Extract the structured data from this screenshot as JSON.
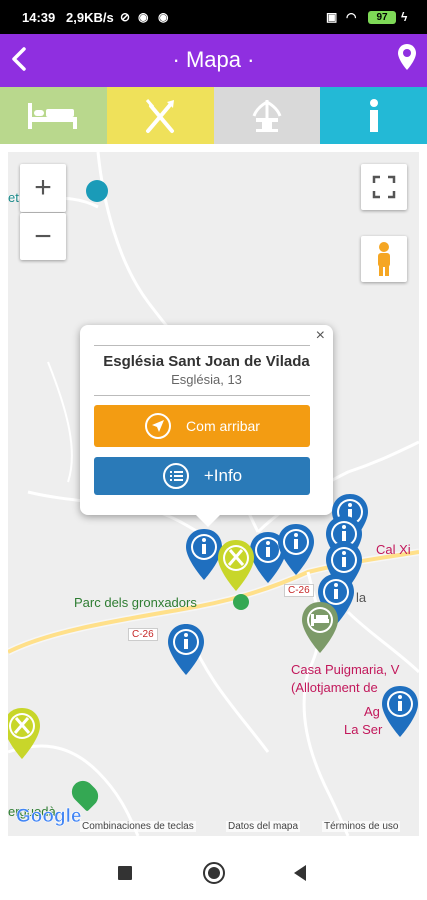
{
  "status_bar": {
    "time": "14:39",
    "speed": "2,9KB/s",
    "battery": "97"
  },
  "header": {
    "title": "· Mapa ·",
    "back_icon": "chevron-left-icon",
    "location_icon": "map-pin-icon",
    "background": "#8f2fe0"
  },
  "categories": [
    {
      "name": "accommodation",
      "icon": "bed-icon",
      "color": "#b9d88d"
    },
    {
      "name": "restaurants",
      "icon": "cutlery-icon",
      "color": "#efe15a"
    },
    {
      "name": "leisure",
      "icon": "fountain-icon",
      "color": "#d9d9d9"
    },
    {
      "name": "information",
      "icon": "info-icon",
      "color": "#23b9d6"
    }
  ],
  "map": {
    "zoom_in": "+",
    "zoom_out": "−",
    "labels": {
      "top_left": "et",
      "park": "Parc dels gronxadors",
      "road1": "C-26",
      "road2": "C-26",
      "cal": "Cal Xi",
      "la": "la",
      "casa1": "Casa Puigmaria, V",
      "casa2": "(Allotjament de",
      "ag": "Ag",
      "serie": "La Ser",
      "bergueda": "erguedà"
    },
    "footer": {
      "google": "Google",
      "shortcuts": "Combinaciones de teclas",
      "map_data": "Datos del mapa",
      "terms": "Términos de uso"
    }
  },
  "popup": {
    "title": "Església Sant Joan de Vilada",
    "address": "Església, 13",
    "route_button": "Com arribar",
    "info_button": "+Info",
    "close": "×"
  },
  "colors": {
    "info_marker": "#1f6fbf",
    "food_marker": "#c8d62a",
    "hotel_marker": "#7c9a68",
    "route_button": "#f39c12",
    "info_button": "#2a7ab8"
  }
}
